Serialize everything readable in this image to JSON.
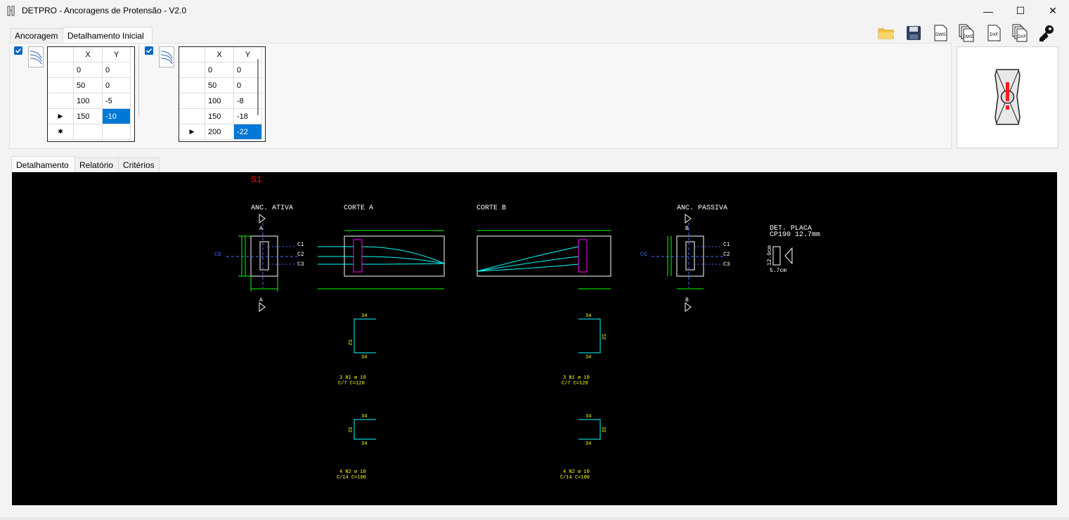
{
  "window": {
    "title": "DETPRO - Ancoragens de Protensão - V2.0",
    "minimize_glyph": "—",
    "maximize_glyph": "☐",
    "close_glyph": "✕"
  },
  "top_tabs": [
    {
      "label": "Ancoragem",
      "active": false
    },
    {
      "label": "Detalhamento Inicial",
      "active": true
    }
  ],
  "toolbar": [
    {
      "name": "open-folder-icon",
      "label": ""
    },
    {
      "name": "save-icon",
      "label": ""
    },
    {
      "name": "dwg-export-icon",
      "label": "DWG"
    },
    {
      "name": "dwg-multi-export-icon",
      "label": "DWG"
    },
    {
      "name": "dxf-export-icon",
      "label": "DXF"
    },
    {
      "name": "dxf-multi-export-icon",
      "label": "DXF"
    },
    {
      "name": "key-icon",
      "label": ""
    }
  ],
  "grid1": {
    "headers": [
      "X",
      "Y"
    ],
    "rows": [
      {
        "indicator": "",
        "x": "0",
        "y": "0"
      },
      {
        "indicator": "",
        "x": "50",
        "y": "0"
      },
      {
        "indicator": "",
        "x": "100",
        "y": "-5"
      },
      {
        "indicator": "▶",
        "x": "150",
        "y": "-10"
      },
      {
        "indicator": "✱",
        "x": "",
        "y": ""
      }
    ]
  },
  "grid2": {
    "headers": [
      "X",
      "Y"
    ],
    "rows": [
      {
        "indicator": "",
        "x": "0",
        "y": "0"
      },
      {
        "indicator": "",
        "x": "50",
        "y": "0"
      },
      {
        "indicator": "",
        "x": "100",
        "y": "-8"
      },
      {
        "indicator": "",
        "x": "150",
        "y": "-18"
      },
      {
        "indicator": "▶",
        "x": "200",
        "y": "-22"
      }
    ]
  },
  "bottom_tabs": [
    {
      "label": "Detalhamento",
      "active": true
    },
    {
      "label": "Relatório",
      "active": false
    },
    {
      "label": "Critérios",
      "active": false
    }
  ],
  "drawing": {
    "section_id": "S1",
    "anc_ativa": "ANC. ATIVA",
    "corte_a": "CORTE A",
    "corte_b": "CORTE B",
    "anc_passiva": "ANC. PASSIVA",
    "det_placa_1": "DET. PLACA",
    "det_placa_2": "CP190 12.7mm",
    "cg": "CG",
    "c1": "C1",
    "c2": "C2",
    "c3": "C3",
    "mark_a": "A",
    "mark_b": "B",
    "plate_w": "5.7cm",
    "plate_h": "12.9cm",
    "stirrup_dim": "34",
    "stirrup_h1": "52",
    "stirrup_h2": "32",
    "rebar1_a": "3 N1 ø 10",
    "rebar1_b": "C/7 C=120",
    "rebar2_a": "4 N2 ø 10",
    "rebar2_b": "C/14 C=100",
    "colors": {
      "bg": "#000000",
      "green": "#00ff00",
      "cyan": "#00ffff",
      "white": "#ffffff",
      "yellow": "#ffff00",
      "magenta": "#ff00ff",
      "red": "#ff0000",
      "blue": "#4a6cff"
    }
  }
}
